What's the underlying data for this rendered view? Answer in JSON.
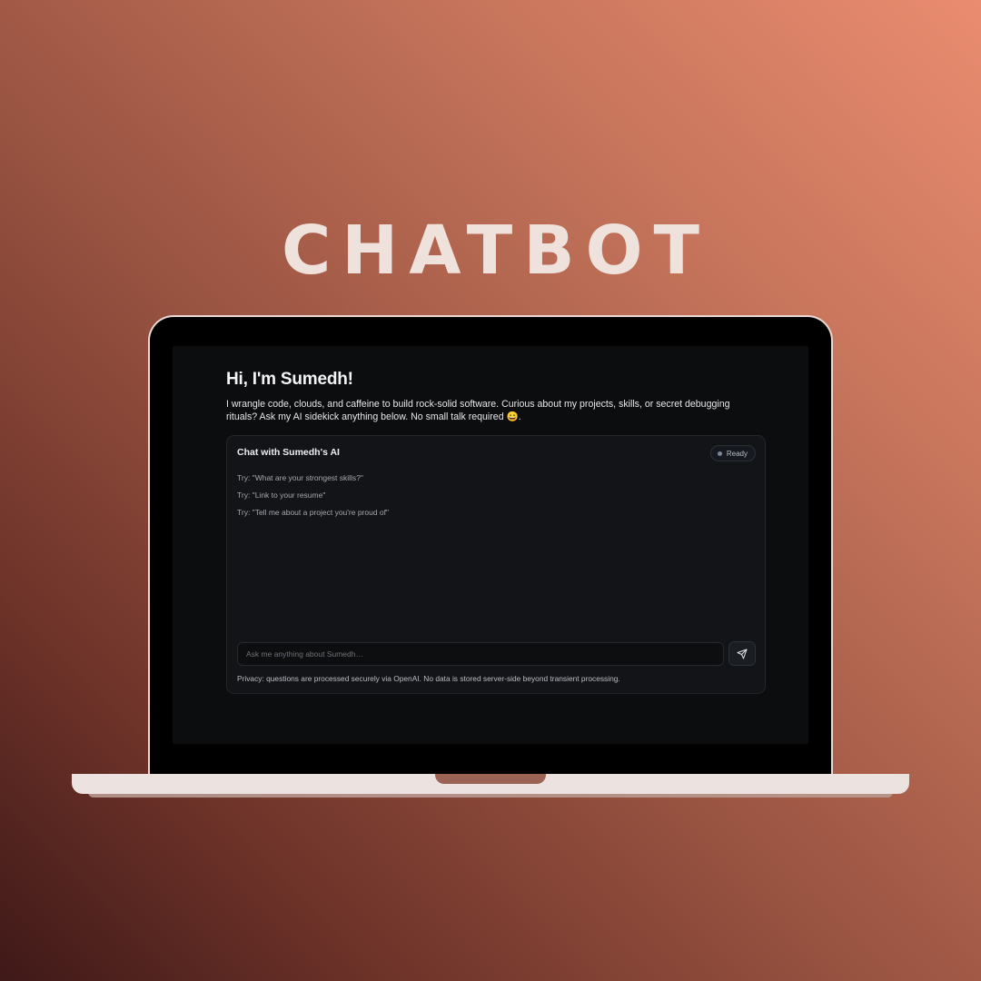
{
  "headline": "CHATBOT",
  "page": {
    "title": "Hi, I'm Sumedh!",
    "intro": "I wrangle code, clouds, and caffeine to build rock-solid software. Curious about my projects, skills, or secret debugging rituals? Ask my AI sidekick anything below. No small talk required 😄."
  },
  "chat": {
    "title": "Chat with Sumedh's AI",
    "status": "Ready",
    "suggestions": [
      "Try: \"What are your strongest skills?\"",
      "Try: \"Link to your resume\"",
      "Try: \"Tell me about a project you're proud of\""
    ],
    "input_placeholder": "Ask me anything about Sumedh…",
    "input_value": "",
    "send_icon": "send-icon",
    "privacy": "Privacy: questions are processed securely via OpenAI. No data is stored server-side beyond transient processing."
  },
  "colors": {
    "background_light": "#ea8c70",
    "background_dark": "#3f1918",
    "screen_bg": "#0c0d0f",
    "card_bg": "#131417",
    "laptop_frame": "#ece2df"
  }
}
